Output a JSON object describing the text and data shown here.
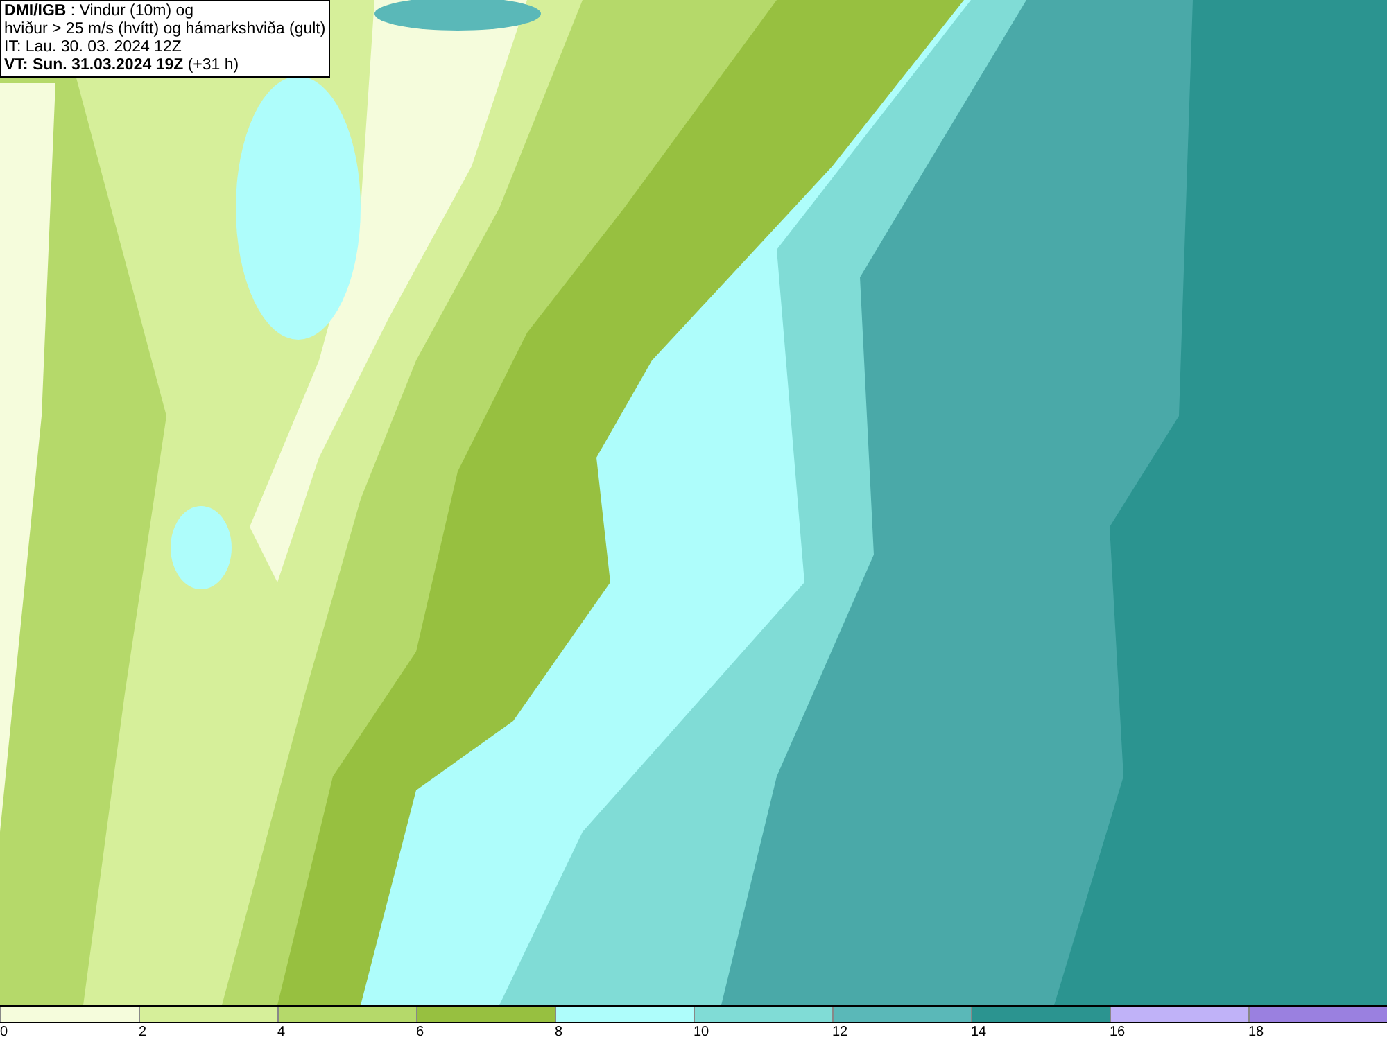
{
  "title_box": {
    "lines": [
      "**DMI/IGB** : Vindur (10m) og",
      "hviður > 25 m/s (hvítt) og hámarkshviða (gult)",
      "IT: Lau. 30. 03. 2024 12Z",
      "**VT: Sun. 31.03.2024 19Z** (+31 h)"
    ]
  },
  "legend": {
    "segments": [
      {
        "color": "#f5fcdc"
      },
      {
        "color": "#d6ef9a"
      },
      {
        "color": "#b5d96a"
      },
      {
        "color": "#97c040"
      },
      {
        "color": "#aefdfb"
      },
      {
        "color": "#80dcd6"
      },
      {
        "color": "#5ab8b8"
      },
      {
        "color": "#2b9490"
      },
      {
        "color": "#c0b2f8"
      },
      {
        "color": "#9a80e0"
      }
    ],
    "ticks": [
      "0",
      "2",
      "4",
      "6",
      "8",
      "10",
      "12",
      "14",
      "16",
      "18"
    ]
  }
}
